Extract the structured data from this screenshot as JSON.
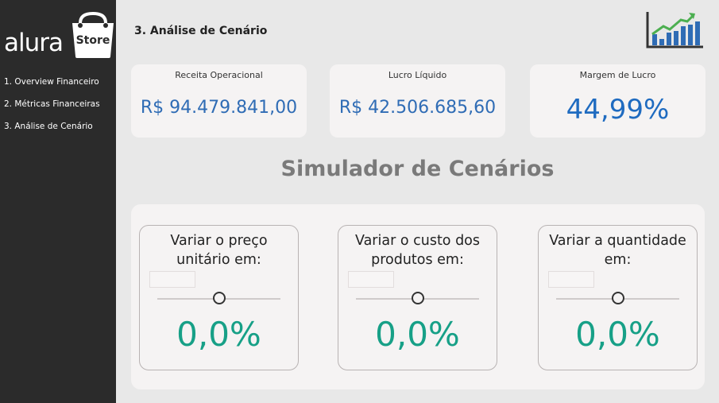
{
  "sidebar": {
    "logo": {
      "word": "alura",
      "badge": "Store"
    },
    "items": [
      {
        "label": "1. Overview Financeiro"
      },
      {
        "label": "2. Métricas Financeiras"
      },
      {
        "label": "3. Análise de Cenário"
      }
    ]
  },
  "header": {
    "title": "3. Análise de Cenário",
    "icon": "growth-chart-icon"
  },
  "kpis": [
    {
      "label": "Receita Operacional",
      "value": "R$ 94.479.841,00"
    },
    {
      "label": "Lucro Líquido",
      "value": "R$ 42.506.685,60"
    },
    {
      "label": "Margem de Lucro",
      "value": "44,99%"
    }
  ],
  "simulator": {
    "title": "Simulador de Cenários",
    "cards": [
      {
        "label": "Variar o preço unitário em:",
        "value": "0,0%",
        "slider_level": 0.5
      },
      {
        "label": "Variar o custo dos produtos em:",
        "value": "0,0%",
        "slider_level": 0.5
      },
      {
        "label": "Variar a quantidade em:",
        "value": "0,0%",
        "slider_level": 0.5
      }
    ]
  },
  "colors": {
    "sidebar": "#2b2b2b",
    "background": "#e8e8e8",
    "kpi_value": "#2f6cb5",
    "sim_value": "#17a087",
    "chart_green": "#4caf50",
    "chart_blue": "#2f6cb5"
  }
}
